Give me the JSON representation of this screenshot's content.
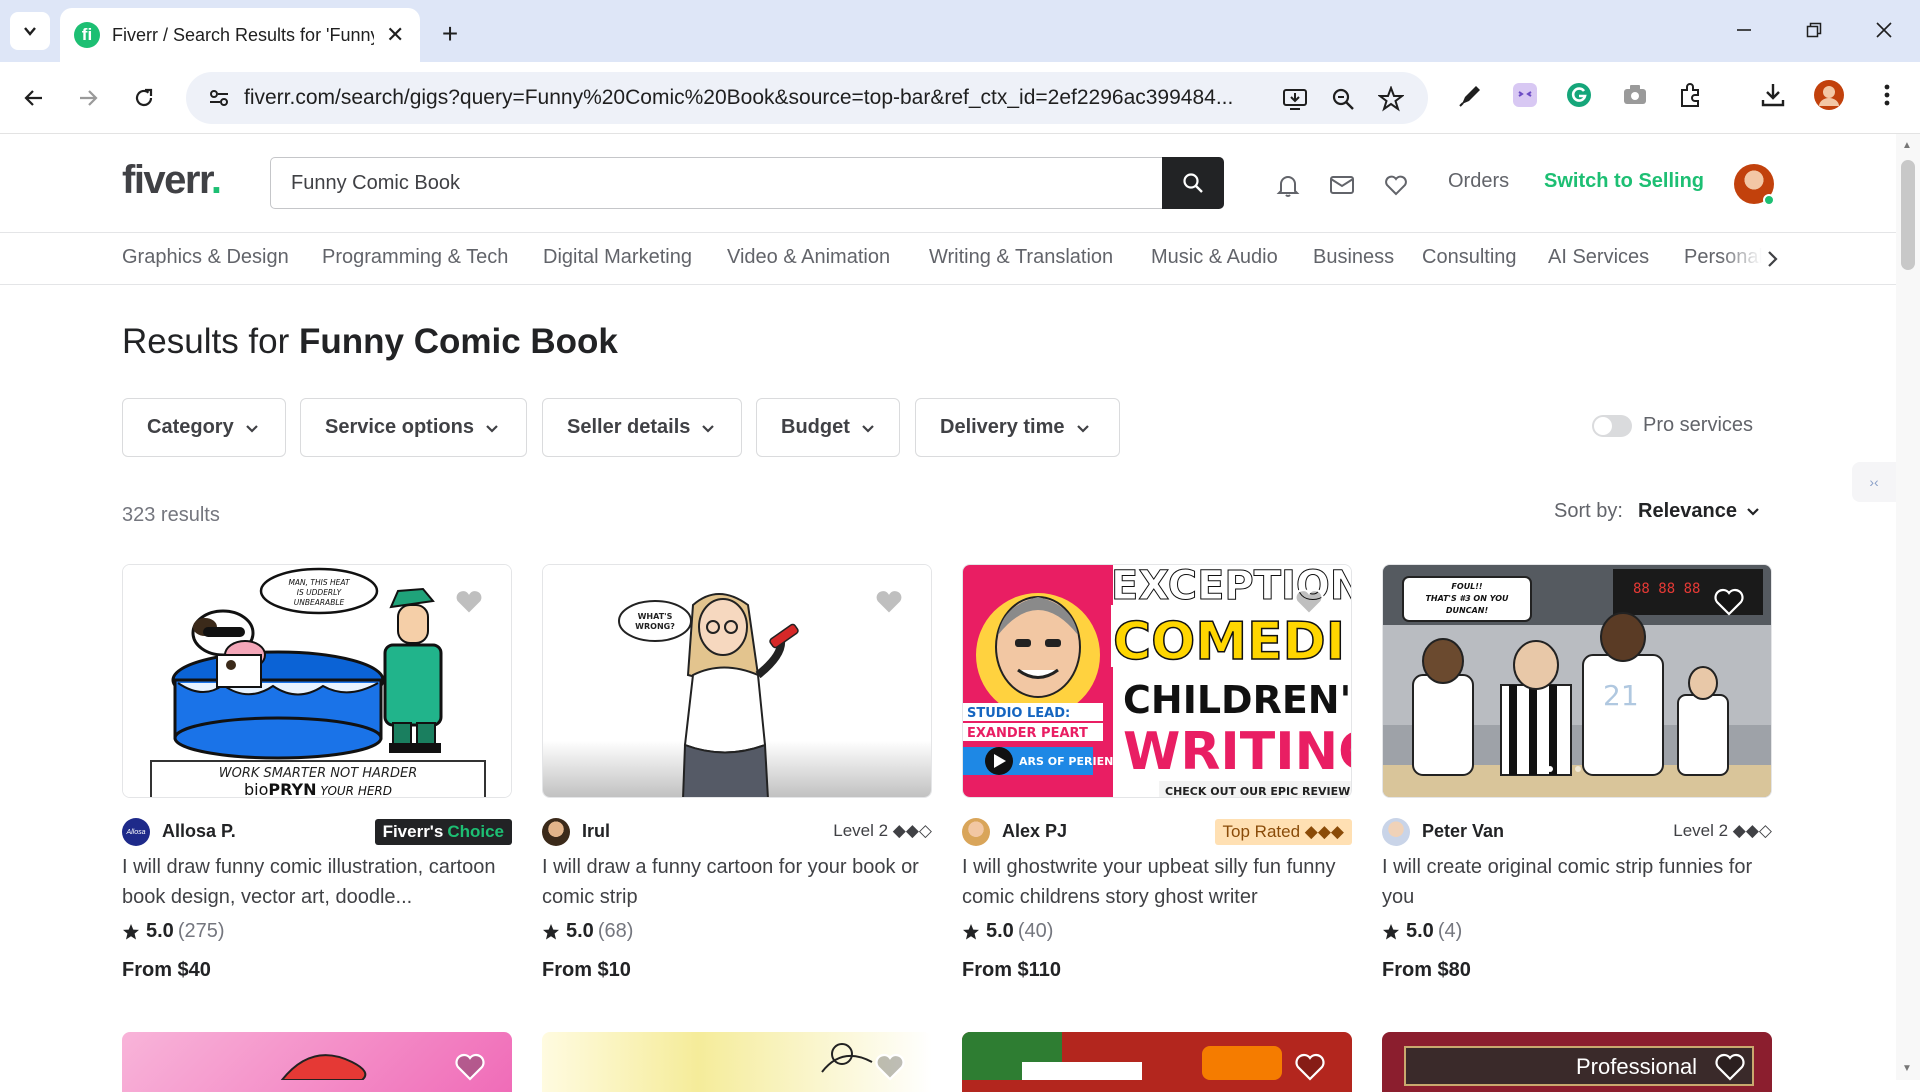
{
  "browser": {
    "tab_title": "Fiverr / Search Results for 'Funny Comic Book'",
    "favicon_letter": "fi",
    "new_tab": "+",
    "close": "✕",
    "url": "fiverr.com/search/gigs?query=Funny%20Comic%20Book&source=top-bar&ref_ctx_id=2ef2296ac399484..."
  },
  "header": {
    "logo": "fiverr",
    "logo_dot": ".",
    "search_value": "Funny Comic Book",
    "orders": "Orders",
    "switch_selling": "Switch to Selling"
  },
  "categories": [
    "Graphics & Design",
    "Programming & Tech",
    "Digital Marketing",
    "Video & Animation",
    "Writing & Translation",
    "Music & Audio",
    "Business",
    "Consulting",
    "AI Services",
    "Personal"
  ],
  "results": {
    "prefix": "Results for ",
    "query": "Funny Comic Book",
    "count": "323 results",
    "sort_label": "Sort by:",
    "sort_value": "Relevance"
  },
  "filters": {
    "category": "Category",
    "service_options": "Service options",
    "seller_details": "Seller details",
    "budget": "Budget",
    "delivery_time": "Delivery time",
    "pro_services": "Pro services",
    "pro_services_on": false
  },
  "side_widget": "›‹",
  "gigs": [
    {
      "seller": "Allosa P.",
      "avatar_text": "Allosa",
      "badge_type": "choice",
      "badge_main": "Fiverr's",
      "badge_accent": "Choice",
      "title": "I will draw funny comic illustration, cartoon book design, vector art, doodle...",
      "rating": "5.0",
      "reviews": "(275)",
      "price": "From $40",
      "thumb": {
        "bubble": "MAN, THIS HEAT IS UDDERLY UNBEARABLE",
        "tagline": "WORK SMARTER NOT HARDER",
        "brand_pre": "bio",
        "brand_main": "PRYN",
        "brand_post": " YOUR HERD"
      }
    },
    {
      "seller": "Irul",
      "badge_type": "level",
      "level": "Level 2 ◆◆◇",
      "title": "I will draw a funny cartoon for your book or comic strip",
      "rating": "5.0",
      "reviews": "(68)",
      "price": "From $10",
      "thumb": {
        "bubble": "WHAT'S WRONG?"
      }
    },
    {
      "seller": "Alex PJ",
      "badge_type": "toprated",
      "level": "Top Rated ◆◆◆",
      "title": "I will ghostwrite your upbeat silly fun funny comic childrens story ghost writer",
      "rating": "5.0",
      "reviews": "(40)",
      "price": "From $110",
      "thumb": {
        "line1": "EXCEPTIONA",
        "line2": "COMEDI",
        "line3": "CHILDREN'S",
        "line4": "WRITING",
        "lead1": "STUDIO LEAD:",
        "lead2": "EXANDER PEART",
        "years": "ARS OF PERIENCE",
        "reviews": "CHECK OUT OUR EPIC REVIEWS"
      }
    },
    {
      "seller": "Peter Van",
      "badge_type": "level",
      "level": "Level 2 ◆◆◇",
      "title": "I will create original comic strip funnies for you",
      "rating": "5.0",
      "reviews": "(4)",
      "price": "From $80",
      "thumb": {
        "bubble": "FOUL!! THAT'S #3 ON YOU DUNCAN!"
      }
    }
  ],
  "next_row": [
    {
      "label": ""
    },
    {
      "label": ""
    },
    {
      "label": ""
    },
    {
      "label": "Professional"
    }
  ],
  "colors": {
    "brand_green": "#1dbf73",
    "text_dark": "#222325",
    "text_body": "#404145",
    "top_rated_bg": "#ffe0b3"
  }
}
